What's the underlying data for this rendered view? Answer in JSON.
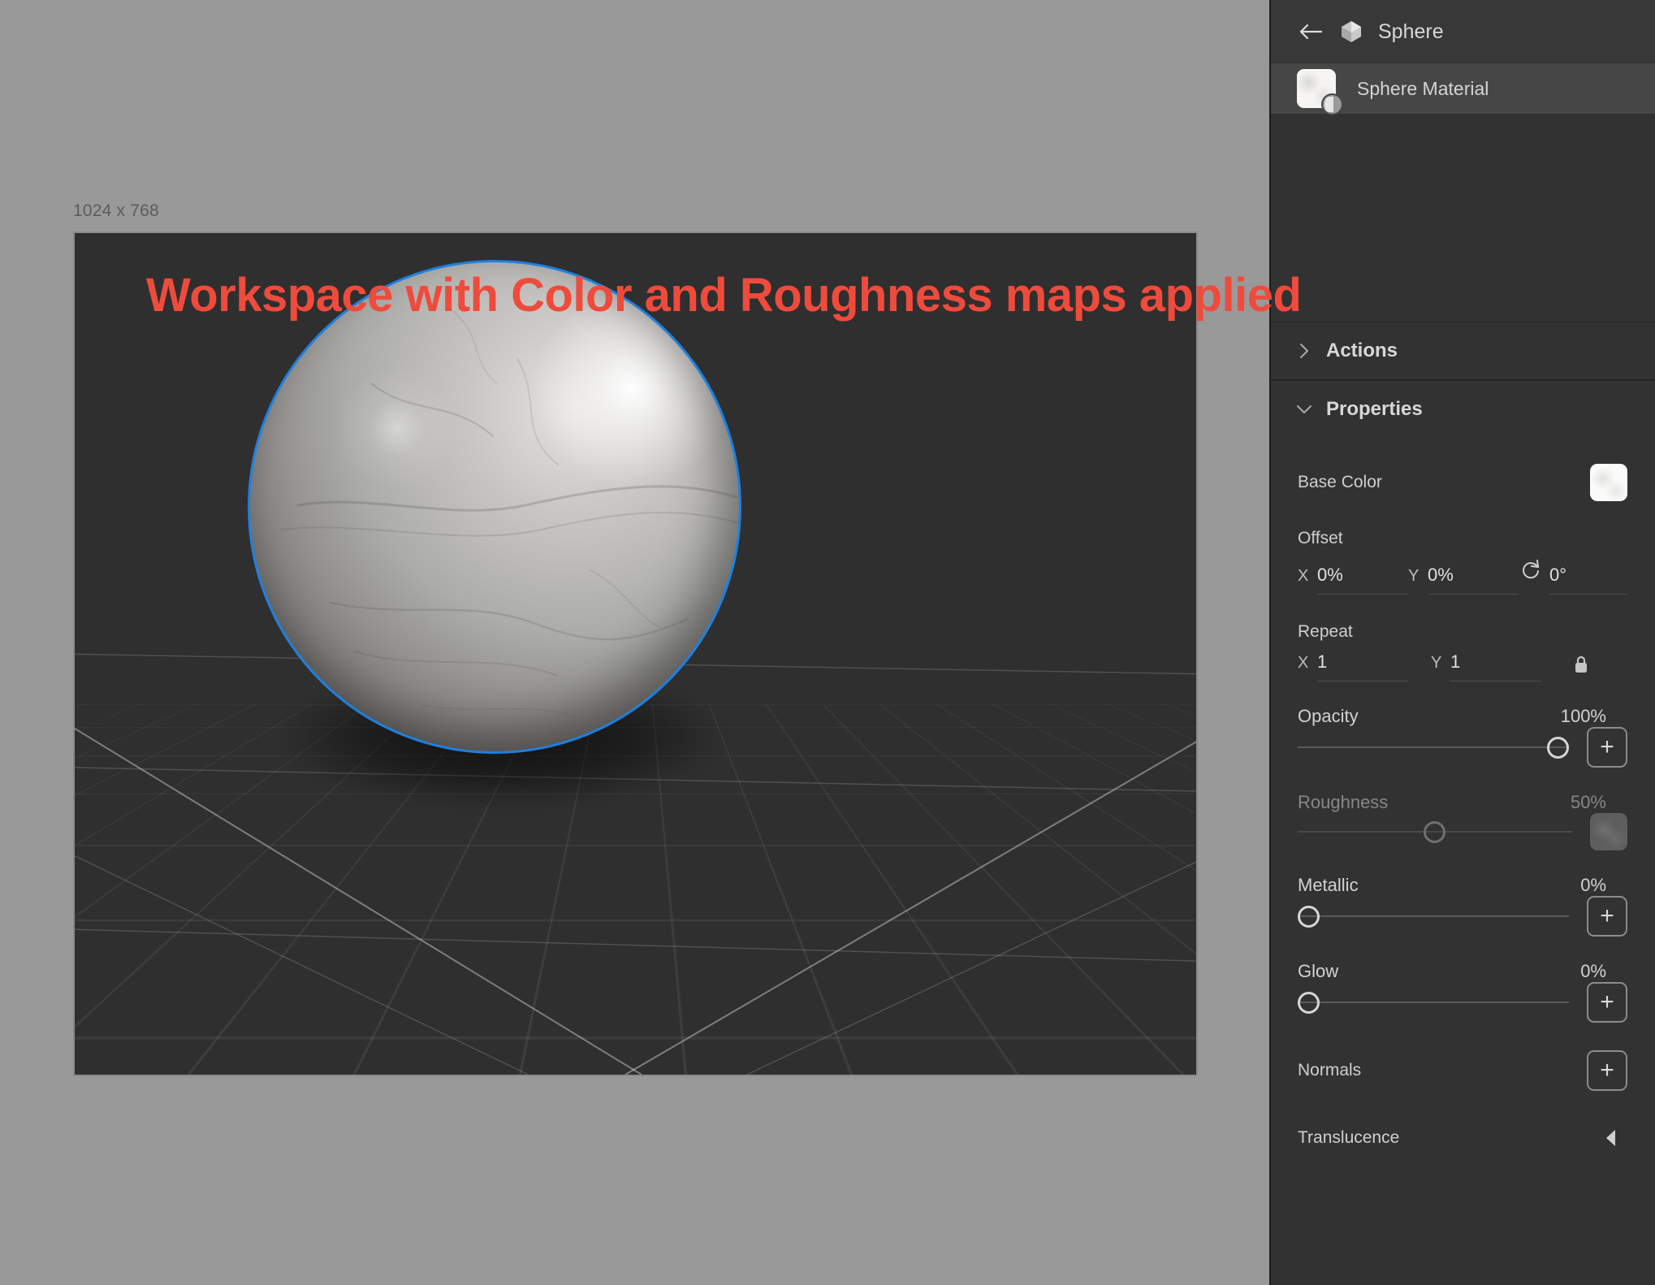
{
  "workspace": {
    "canvas_size_label": "1024 x 768",
    "annotation_text": "Workspace with Color and Roughness maps applied",
    "annotation_color": "#ef4b3c",
    "selection_outline_color": "#1e80e0",
    "viewport_background": "#2f2f2f",
    "workspace_background": "#999999"
  },
  "panel": {
    "back_icon": "arrow-left-icon",
    "object_icon": "cube-icon",
    "object_title": "Sphere",
    "material": {
      "name": "Sphere Material",
      "thumbnail_icon": "material-thumbnail",
      "badge_icon": "sphere-badge-icon"
    },
    "sections": [
      {
        "id": "actions",
        "title": "Actions",
        "chevron": "chevron-right-icon",
        "expanded": false
      },
      {
        "id": "properties",
        "title": "Properties",
        "chevron": "chevron-down-icon",
        "expanded": true
      }
    ],
    "properties": {
      "base_color": {
        "label": "Base Color",
        "swatch_icon": "base-color-swatch"
      },
      "offset": {
        "label": "Offset",
        "x_axis": "X",
        "x_value": "0%",
        "y_axis": "Y",
        "y_value": "0%",
        "rotation_icon": "rotate-icon",
        "rotation_value": "0°"
      },
      "repeat": {
        "label": "Repeat",
        "x_axis": "X",
        "x_value": "1",
        "y_axis": "Y",
        "y_value": "1",
        "lock_icon": "lock-icon"
      },
      "sliders": [
        {
          "id": "opacity",
          "label": "Opacity",
          "value": "100%",
          "percent": 100,
          "control": "add",
          "add_icon": "plus-icon",
          "dimmed": false
        },
        {
          "id": "roughness",
          "label": "Roughness",
          "value": "50%",
          "percent": 50,
          "control": "texture",
          "texture_icon": "roughness-map-thumbnail",
          "dimmed": true
        },
        {
          "id": "metallic",
          "label": "Metallic",
          "value": "0%",
          "percent": 0,
          "control": "add",
          "add_icon": "plus-icon",
          "dimmed": false
        },
        {
          "id": "glow",
          "label": "Glow",
          "value": "0%",
          "percent": 0,
          "control": "add",
          "add_icon": "plus-icon",
          "dimmed": false
        }
      ],
      "normals": {
        "label": "Normals",
        "add_icon": "plus-icon"
      },
      "translucence": {
        "label": "Translucence",
        "expand_icon": "caret-left-icon"
      }
    }
  }
}
